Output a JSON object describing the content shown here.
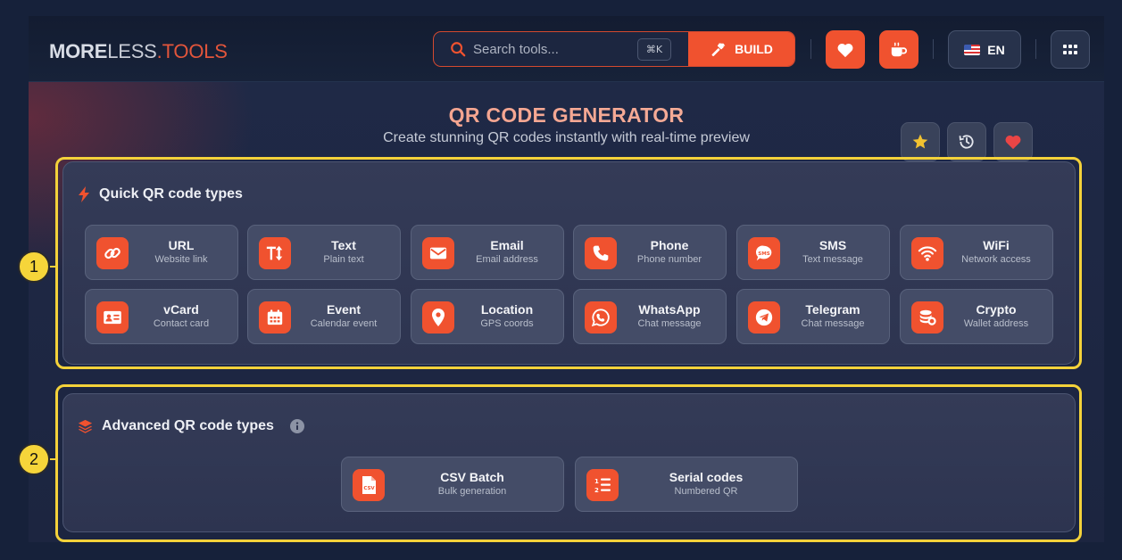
{
  "header": {
    "logo": {
      "part1": "MORE",
      "part2": "LESS",
      "part3": ".TOOLS"
    },
    "search": {
      "placeholder": "Search tools...",
      "shortcut": "⌘K",
      "build_label": "BUILD"
    },
    "language": "EN",
    "icons": {
      "search": "search-icon",
      "build": "hammer-icon",
      "favorite": "heart-icon",
      "coffee": "coffee-icon",
      "apps": "grid-icon"
    }
  },
  "main": {
    "title": "QR CODE GENERATOR",
    "subtitle": "Create stunning QR codes instantly with real-time preview",
    "actions": [
      "star-icon",
      "history-icon",
      "heart-icon"
    ],
    "quick": {
      "heading": "Quick QR code types",
      "items": [
        {
          "name": "URL",
          "desc": "Website link",
          "icon": "link-icon"
        },
        {
          "name": "Text",
          "desc": "Plain text",
          "icon": "text-icon"
        },
        {
          "name": "Email",
          "desc": "Email address",
          "icon": "envelope-icon"
        },
        {
          "name": "Phone",
          "desc": "Phone number",
          "icon": "phone-icon"
        },
        {
          "name": "SMS",
          "desc": "Text message",
          "icon": "sms-icon"
        },
        {
          "name": "WiFi",
          "desc": "Network access",
          "icon": "wifi-icon"
        },
        {
          "name": "vCard",
          "desc": "Contact card",
          "icon": "id-card-icon"
        },
        {
          "name": "Event",
          "desc": "Calendar event",
          "icon": "calendar-icon"
        },
        {
          "name": "Location",
          "desc": "GPS coords",
          "icon": "location-pin-icon"
        },
        {
          "name": "WhatsApp",
          "desc": "Chat message",
          "icon": "whatsapp-icon"
        },
        {
          "name": "Telegram",
          "desc": "Chat message",
          "icon": "telegram-icon"
        },
        {
          "name": "Crypto",
          "desc": "Wallet address",
          "icon": "coins-icon"
        }
      ]
    },
    "advanced": {
      "heading": "Advanced QR code types",
      "items": [
        {
          "name": "CSV Batch",
          "desc": "Bulk generation",
          "icon": "csv-file-icon"
        },
        {
          "name": "Serial codes",
          "desc": "Numbered QR",
          "icon": "numbered-list-icon"
        }
      ]
    }
  },
  "annotations": {
    "marker1": "1",
    "marker2": "2"
  },
  "colors": {
    "accent": "#f0522f",
    "highlight": "#f4d23a",
    "background": "#16213a"
  }
}
